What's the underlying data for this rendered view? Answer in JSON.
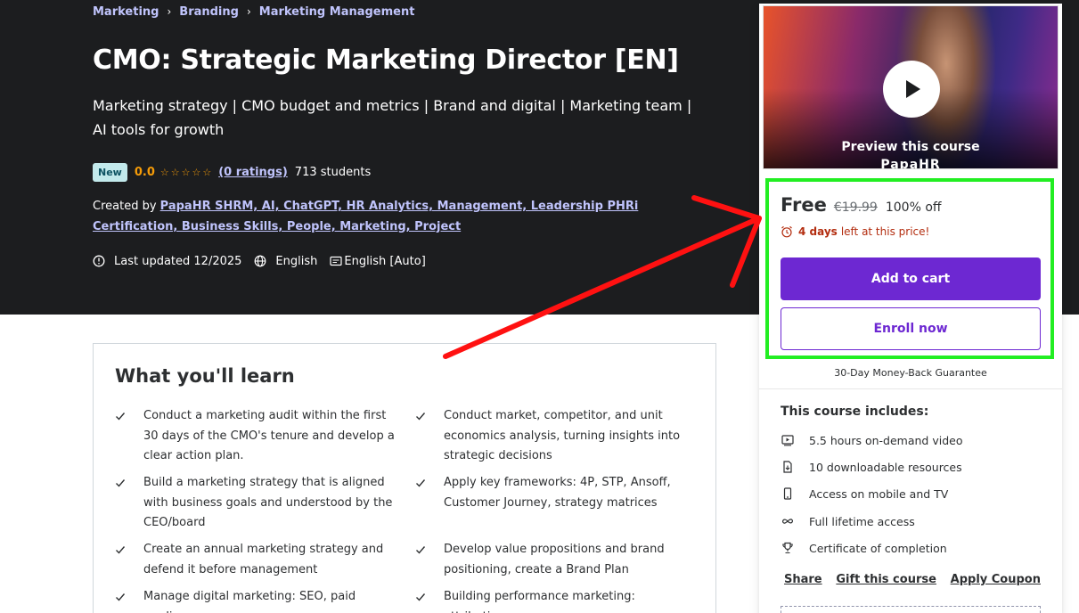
{
  "breadcrumb": {
    "items": [
      "Marketing",
      "Branding",
      "Marketing Management"
    ],
    "separator": "›"
  },
  "course": {
    "title": "CMO: Strategic Marketing Director [EN]",
    "subtitle": "Marketing strategy | CMO budget and metrics | Brand and digital | Marketing team | AI tools for growth",
    "badge": "New",
    "rating": "0.0",
    "stars": "☆☆☆☆☆",
    "ratings_link": "(0 ratings)",
    "students": "713 students",
    "created_by_label": "Created by",
    "instructor": "PapaHR  SHRM, AI, ChatGPT, HR Analytics, Management, Leadership PHRi Certification, Business Skills, People, Marketing, Project",
    "last_updated": "Last updated 12/2025",
    "language": "English",
    "captions": "English [Auto]"
  },
  "learn": {
    "heading": "What you'll learn",
    "items": [
      "Conduct a marketing audit within the first 30 days of the CMO's tenure and develop a clear action plan.",
      "Conduct market, competitor, and unit economics analysis, turning insights into strategic decisions",
      "Build a marketing strategy that is aligned with business goals and understood by the CEO/board",
      "Apply key frameworks: 4P, STP, Ansoff, Customer Journey, strategy matrices",
      "Create an annual marketing strategy and defend it before management",
      "Develop value propositions and brand positioning, create a Brand Plan",
      "Manage digital marketing: SEO, paid media,",
      "Building performance marketing: attribution,"
    ]
  },
  "sidebar": {
    "preview_label": "Preview this course",
    "brand_mark": "PapaHR",
    "price": "Free",
    "original_price": "€19.99",
    "discount": "100% off",
    "urgency_days": "4 days",
    "urgency_text": "left at this price!",
    "add_to_cart": "Add to cart",
    "enroll_now": "Enroll now",
    "guarantee": "30-Day Money-Back Guarantee",
    "includes_title": "This course includes:",
    "includes": [
      {
        "icon": "video-icon",
        "label": "5.5 hours on-demand video"
      },
      {
        "icon": "file-download-icon",
        "label": "10 downloadable resources"
      },
      {
        "icon": "mobile-icon",
        "label": "Access on mobile and TV"
      },
      {
        "icon": "infinity-icon",
        "label": "Full lifetime access"
      },
      {
        "icon": "trophy-icon",
        "label": "Certificate of completion"
      }
    ],
    "share": "Share",
    "gift": "Gift this course",
    "coupon": "Apply Coupon"
  },
  "colors": {
    "hero_bg": "#1c1d1f",
    "link_purple": "#c0c4fc",
    "brand_purple": "#6d28d2",
    "star_orange": "#f69c08",
    "urgency_red": "#b32d0f",
    "highlight_green": "#22ee22",
    "arrow_red": "#ff1111"
  }
}
